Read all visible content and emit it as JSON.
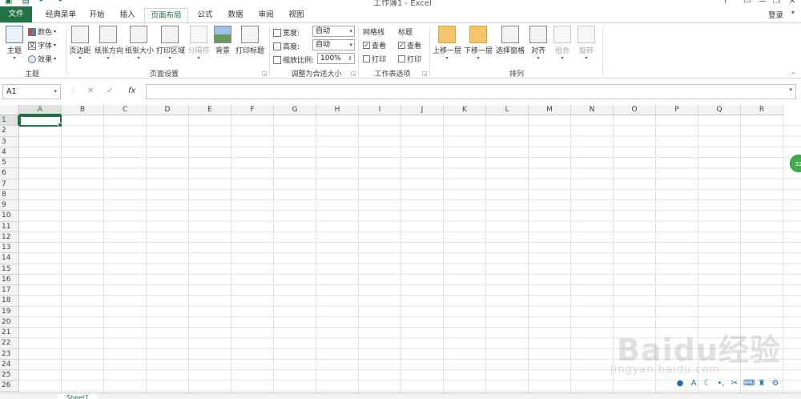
{
  "window": {
    "title": "工作簿1 - Excel",
    "login": "登录"
  },
  "tabs": [
    {
      "label": "文件"
    },
    {
      "label": "经典菜单"
    },
    {
      "label": "开始"
    },
    {
      "label": "插入"
    },
    {
      "label": "页面布局"
    },
    {
      "label": "公式"
    },
    {
      "label": "数据"
    },
    {
      "label": "审阅"
    },
    {
      "label": "视图"
    }
  ],
  "ribbon": {
    "theme": {
      "label": "主题",
      "theme_btn": "主题",
      "colors": "颜色",
      "fonts": "字体",
      "effects": "效果"
    },
    "page_setup": {
      "label": "页面设置",
      "margins": "页边距",
      "orientation": "纸张方向",
      "size": "纸张大小",
      "print_area": "打印区域",
      "breaks": "分隔符",
      "background": "背景",
      "print_titles": "打印标题"
    },
    "scale_to_fit": {
      "label": "调整为合适大小",
      "width_label": "宽度:",
      "width_value": "自动",
      "height_label": "高度:",
      "height_value": "自动",
      "scale_label": "缩放比例:",
      "scale_value": "100%"
    },
    "sheet_options": {
      "label": "工作表选项",
      "gridlines": "网格线",
      "headings": "标题",
      "view": "查看",
      "print": "打印",
      "gridlines_view_checked": true,
      "headings_view_checked": true
    },
    "arrange": {
      "label": "排列",
      "bring_forward": "上移一层",
      "send_backward": "下移一层",
      "selection_pane": "选择窗格",
      "align": "对齐",
      "group": "组合",
      "rotate": "旋转"
    }
  },
  "formula_bar": {
    "name_box": "A1",
    "fx": "fx",
    "value": ""
  },
  "grid": {
    "columns": [
      "A",
      "B",
      "C",
      "D",
      "E",
      "F",
      "G",
      "H",
      "I",
      "J",
      "K",
      "L",
      "M",
      "N",
      "O",
      "P",
      "Q",
      "R"
    ],
    "rows": [
      "1",
      "2",
      "3",
      "4",
      "5",
      "6",
      "7",
      "8",
      "9",
      "10",
      "11",
      "12",
      "13",
      "14",
      "15",
      "16",
      "17",
      "18",
      "19",
      "20",
      "21",
      "22",
      "23",
      "24",
      "25",
      "26"
    ],
    "active_cell": "A1"
  },
  "sheets": [
    {
      "name": "Sheet1"
    }
  ],
  "overlay": {
    "bubble_text": "32",
    "watermark": "Baidu经验",
    "watermark_url": "jingyan.baidu.com"
  },
  "colors": {
    "accent": "#217346",
    "grid": "#e2e2e2",
    "header_bg": "#f3f3f3"
  }
}
